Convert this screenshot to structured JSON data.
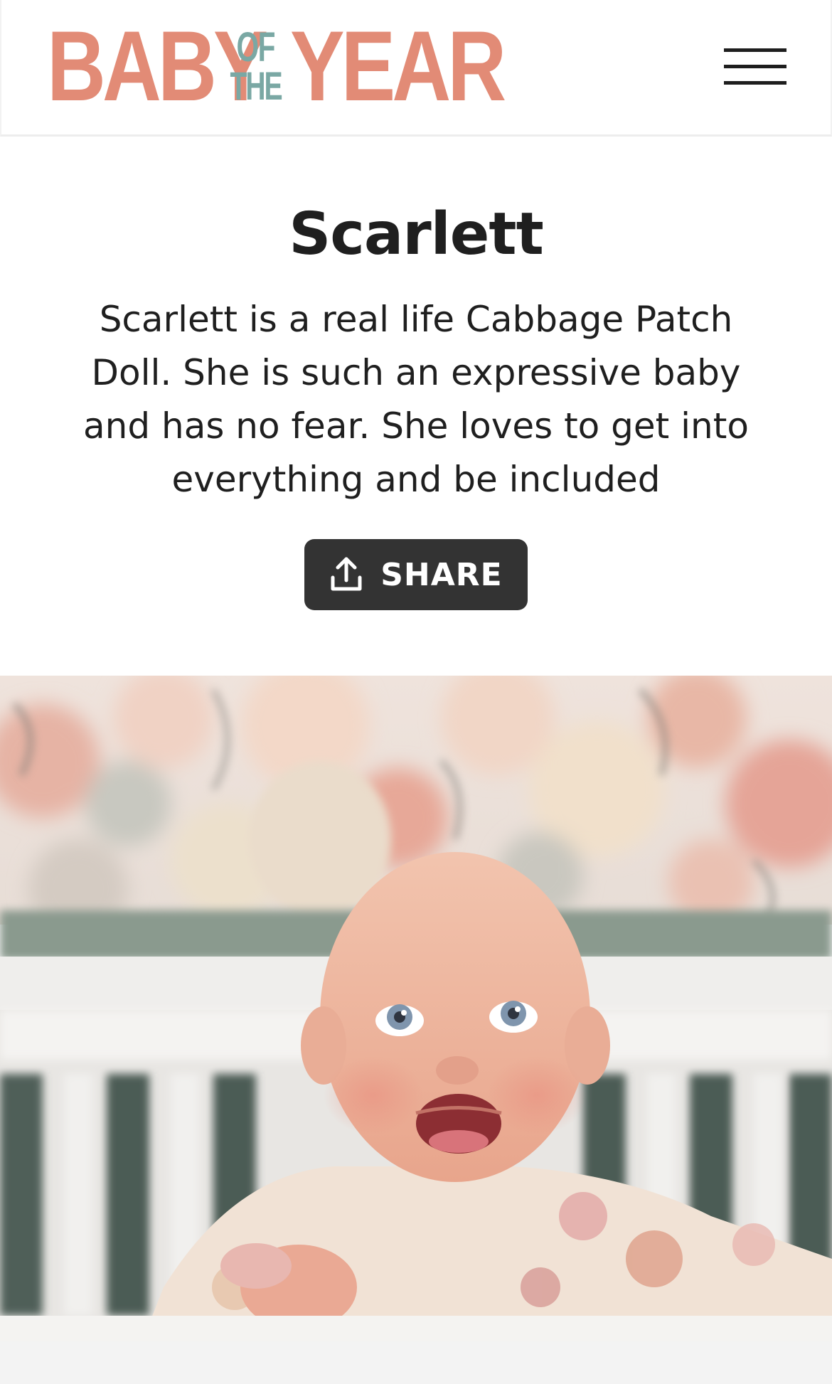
{
  "header": {
    "logo": {
      "word_baby": "BABY",
      "word_of": "OF",
      "word_the": "THE",
      "word_year": "YEAR",
      "primary_color": "#e28b76",
      "secondary_color": "#7aa8a4"
    },
    "menu_icon": "hamburger-menu-icon"
  },
  "profile": {
    "name": "Scarlett",
    "description": "Scarlett is a real life Cabbage Patch Doll. She is such an expressive baby and has no fear. She loves to get into everything and be included",
    "share_label": "SHARE",
    "share_icon": "share-upload-icon"
  },
  "colors": {
    "text": "#1f1f1f",
    "button_bg": "#333333",
    "button_text": "#ffffff",
    "footer_bg": "#f3f3f3"
  }
}
